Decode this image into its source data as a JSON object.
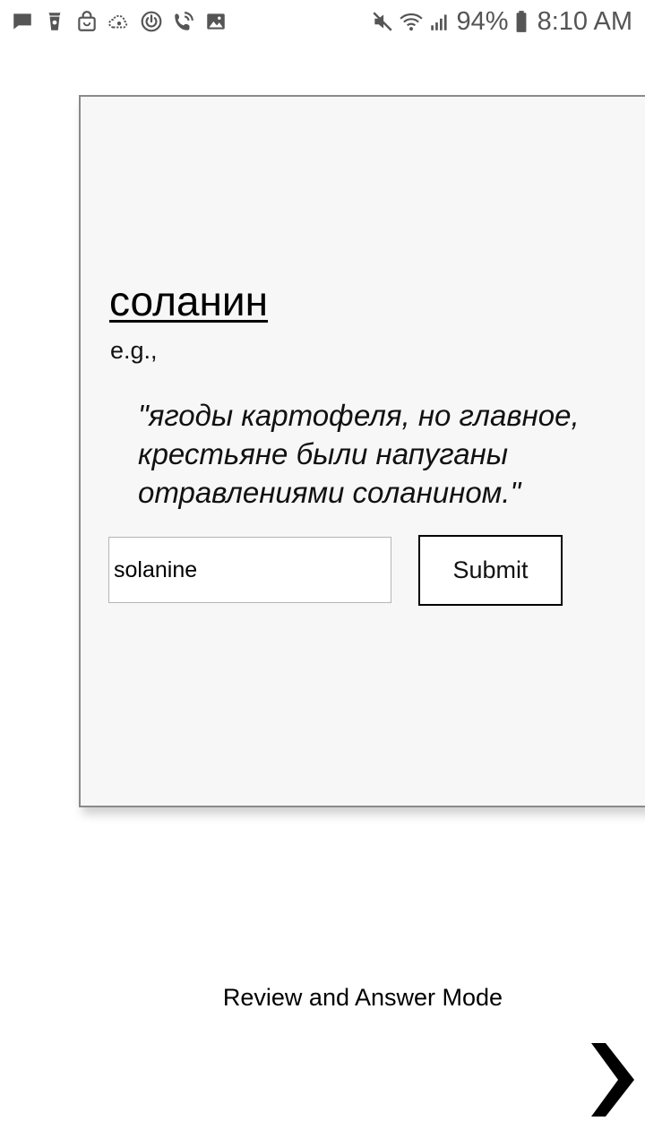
{
  "status_bar": {
    "left_icons": [
      "chat-bubble-icon",
      "coffee-cup-icon",
      "shopping-bag-icon",
      "cloud-sync-icon",
      "power-ring-icon",
      "wifi-call-icon",
      "image-icon"
    ],
    "right_icons": [
      "mute-icon",
      "wifi-icon",
      "signal-icon",
      "battery-icon"
    ],
    "battery_percent": "94%",
    "time": "8:10 AM"
  },
  "card": {
    "term": "соланин",
    "example_label": "e.g.,",
    "example_sentence": "\"ягоды картофеля, но главное, крестьяне были напуганы отравлениями соланином.\"",
    "answer_input": {
      "value": "solanine",
      "placeholder": ""
    },
    "submit_label": "Submit"
  },
  "footer": {
    "mode_label": "Review and Answer Mode"
  },
  "colors": {
    "card_background": "#f7f7f7",
    "card_border": "#8a8a8a",
    "text": "#000000",
    "status_icons": "#555555"
  }
}
